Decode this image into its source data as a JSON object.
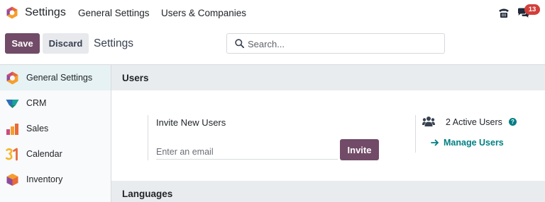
{
  "navbar": {
    "app_name": "Settings",
    "menus": [
      "General Settings",
      "Users & Companies"
    ],
    "notification_count": "13"
  },
  "control_panel": {
    "save_label": "Save",
    "discard_label": "Discard",
    "breadcrumb": "Settings",
    "search_placeholder": "Search..."
  },
  "sidebar": {
    "items": [
      {
        "label": "General Settings",
        "icon": "settings-app-icon",
        "active": true
      },
      {
        "label": "CRM",
        "icon": "crm-app-icon"
      },
      {
        "label": "Sales",
        "icon": "sales-app-icon"
      },
      {
        "label": "Calendar",
        "icon": "calendar-app-icon"
      },
      {
        "label": "Inventory",
        "icon": "inventory-app-icon"
      }
    ]
  },
  "users_section": {
    "title": "Users",
    "invite_title": "Invite New Users",
    "email_placeholder": "Enter an email",
    "invite_label": "Invite",
    "active_users": "2 Active Users",
    "manage_users": "Manage Users"
  },
  "languages_section": {
    "title": "Languages"
  },
  "colors": {
    "primary": "#714b67",
    "link": "#017e84",
    "badge": "#d23f3a"
  }
}
